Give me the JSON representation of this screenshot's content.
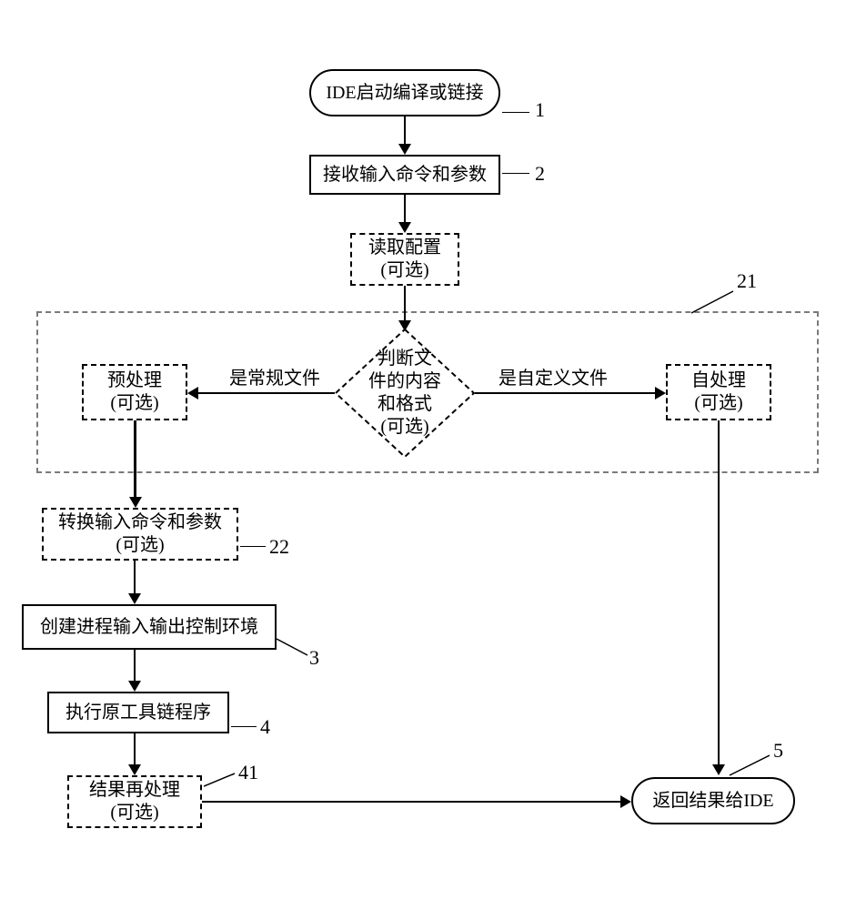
{
  "nodes": {
    "start": {
      "text": "IDE启动编译或链接",
      "num": "1"
    },
    "recv": {
      "text": "接收输入命令和参数",
      "num": "2"
    },
    "readcfg": {
      "l1": "读取配置",
      "l2": "(可选)"
    },
    "container": {
      "num": "21"
    },
    "pre": {
      "l1": "预处理",
      "l2": "(可选)"
    },
    "judge": {
      "l1": "判断文",
      "l2": "件的内容",
      "l3": "和格式",
      "l4": "(可选)"
    },
    "edge_left": "是常规文件",
    "edge_right": "是自定义文件",
    "self": {
      "l1": "自处理",
      "l2": "(可选)"
    },
    "convert": {
      "l1": "转换输入命令和参数",
      "l2": "(可选)",
      "num": "22"
    },
    "createenv": {
      "text": "创建进程输入输出控制环境",
      "num": "3"
    },
    "exec": {
      "text": "执行原工具链程序",
      "num": "4"
    },
    "post": {
      "l1": "结果再处理",
      "l2": "(可选)",
      "num": "41"
    },
    "return": {
      "text": "返回结果给IDE",
      "num": "5"
    }
  }
}
